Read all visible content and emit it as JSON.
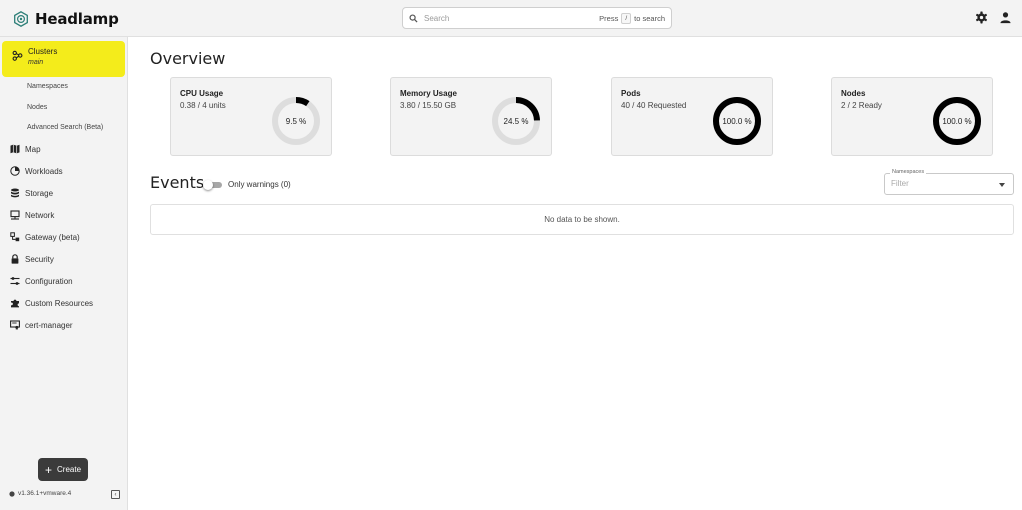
{
  "app": {
    "name": "Headlamp",
    "colors": {
      "accent": "#f4ec1b",
      "sidebar_bg": "#f3f3f3",
      "dark": "#3b3b3b"
    }
  },
  "search": {
    "placeholder": "Search",
    "hint_prefix": "Press",
    "hint_key": "/",
    "hint_suffix": "to search"
  },
  "top_actions": {
    "icons": [
      "settings-icon",
      "user-icon"
    ]
  },
  "sidebar": {
    "cluster": {
      "label": "Clusters",
      "sub": "main",
      "icon": "cluster-icon"
    },
    "sub_items": [
      "Namespaces",
      "Nodes",
      "Advanced Search (Beta)"
    ],
    "items": [
      {
        "label": "Map",
        "icon": "map-icon"
      },
      {
        "label": "Workloads",
        "icon": "workloads-icon"
      },
      {
        "label": "Storage",
        "icon": "storage-icon"
      },
      {
        "label": "Network",
        "icon": "network-icon"
      },
      {
        "label": "Gateway (beta)",
        "icon": "gateway-icon"
      },
      {
        "label": "Security",
        "icon": "lock-icon"
      },
      {
        "label": "Configuration",
        "icon": "configuration-icon"
      },
      {
        "label": "Custom Resources",
        "icon": "puzzle-icon"
      },
      {
        "label": "cert-manager",
        "icon": "certificate-icon"
      }
    ],
    "create_label": "Create",
    "version": "v1.36.1+vmware.4"
  },
  "overview": {
    "title": "Overview",
    "cards": [
      {
        "title": "CPU Usage",
        "sub": "0.38 / 4 units",
        "percent_label": "9.5 %",
        "fraction": 0.095
      },
      {
        "title": "Memory Usage",
        "sub": "3.80 / 15.50 GB",
        "percent_label": "24.5 %",
        "fraction": 0.245
      },
      {
        "title": "Pods",
        "sub": "40 / 40 Requested",
        "percent_label": "100.0 %",
        "fraction": 1.0
      },
      {
        "title": "Nodes",
        "sub": "2 / 2 Ready",
        "percent_label": "100.0 %",
        "fraction": 1.0
      }
    ]
  },
  "events": {
    "title": "Events",
    "toggle_label": "Only warnings (0)",
    "toggle_on": false,
    "namespaces_label": "Namespaces",
    "namespaces_placeholder": "Filter",
    "empty_text": "No data to be shown."
  }
}
